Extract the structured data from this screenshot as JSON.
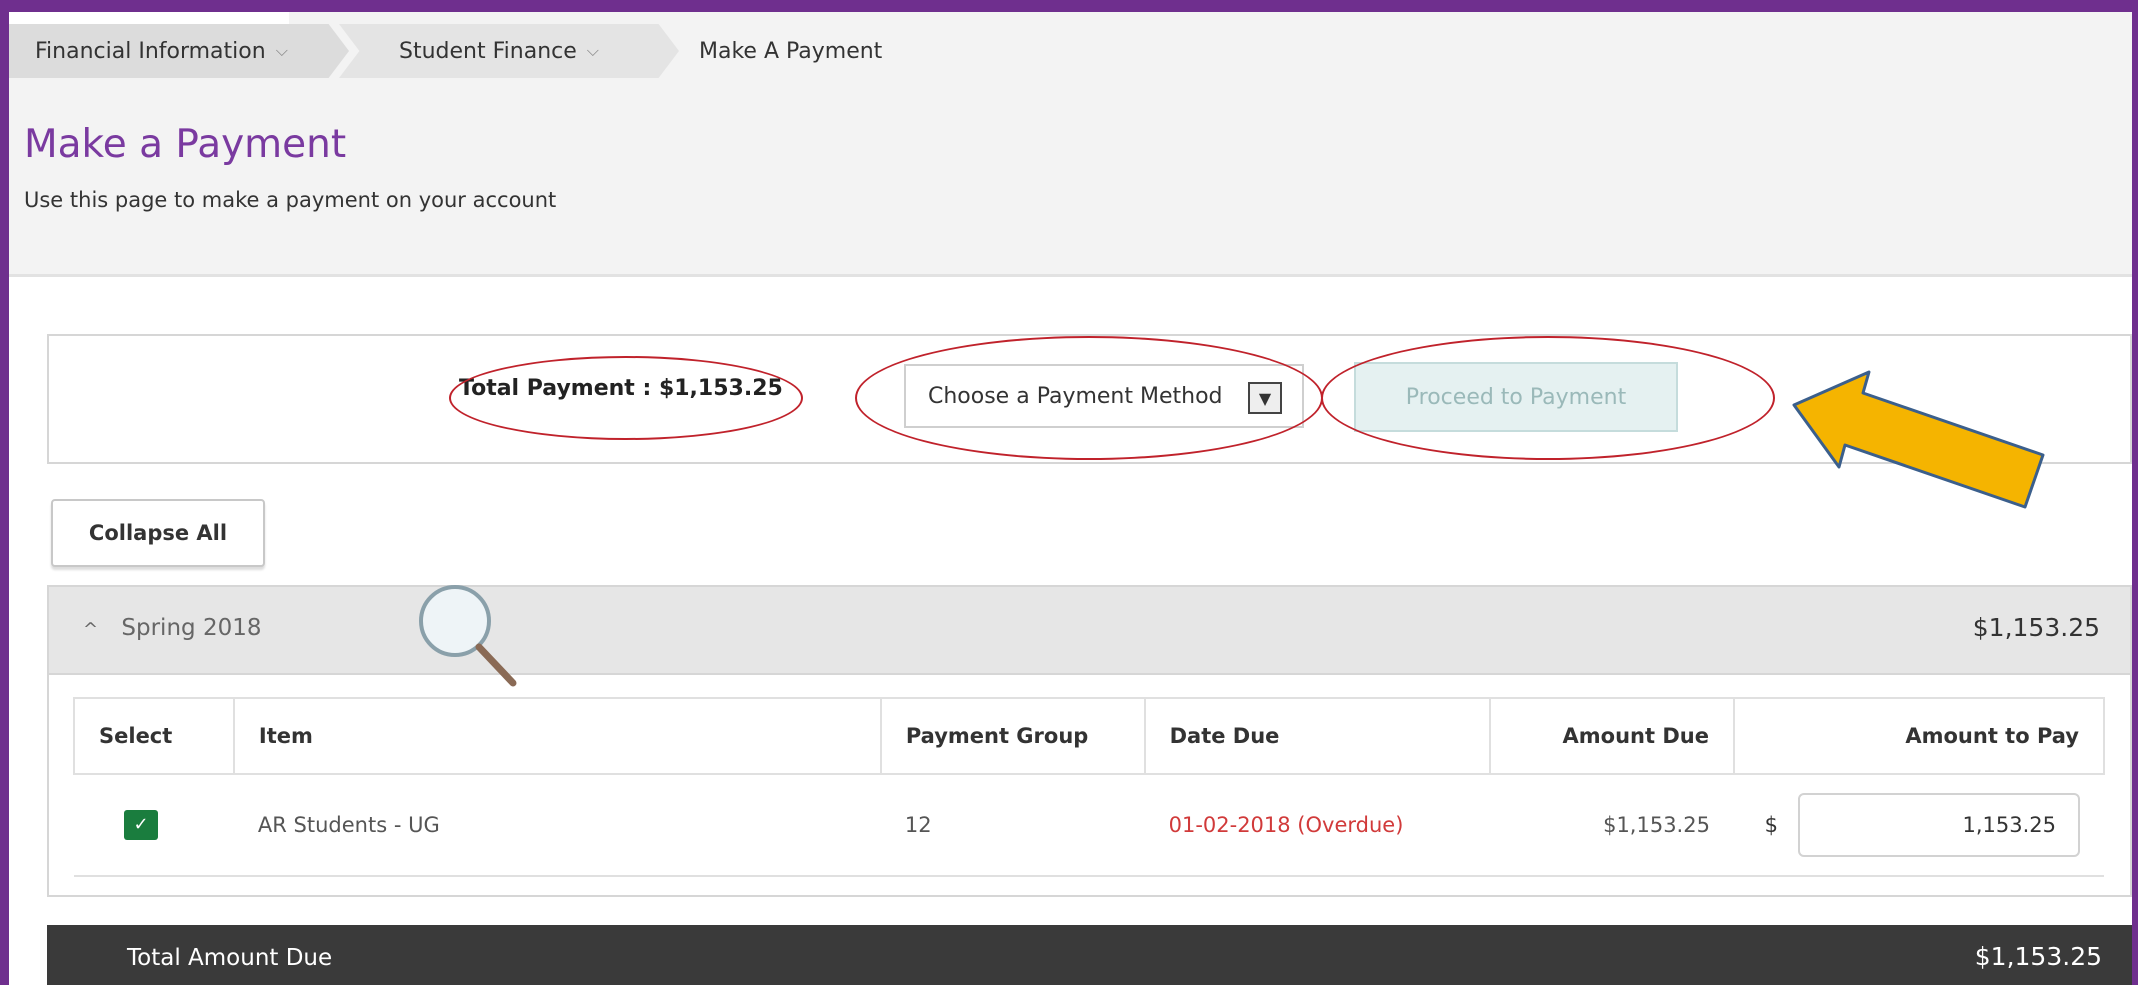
{
  "breadcrumb": {
    "item1": "Financial Information",
    "item2": "Student Finance",
    "item3": "Make A Payment"
  },
  "page": {
    "title": "Make a Payment",
    "subtitle": "Use this page to make a payment on your account"
  },
  "payment_bar": {
    "total_label": "Total Payment : $1,153.25",
    "method_placeholder": "Choose a Payment Method",
    "proceed_label": "Proceed to Payment"
  },
  "collapse_label": "Collapse All",
  "term": {
    "name": "Spring 2018",
    "total": "$1,153.25"
  },
  "table": {
    "headers": {
      "select": "Select",
      "item": "Item",
      "group": "Payment Group",
      "date": "Date Due",
      "amount_due": "Amount Due",
      "amount_pay": "Amount to Pay"
    },
    "rows": [
      {
        "item": "AR Students - UG",
        "group": "12",
        "date_due": "01-02-2018 (Overdue)",
        "amount_due": "$1,153.25",
        "currency": "$",
        "amount_to_pay": "1,153.25"
      }
    ]
  },
  "footer": {
    "label": "Total Amount Due",
    "amount": "$1,153.25"
  },
  "colors": {
    "frame": "#6f2f8e",
    "title": "#7a3aa0",
    "overdue": "#d13a3a",
    "checkbox": "#1a7d3e",
    "annotation_circle": "#c0222b",
    "arrow": "#f5b400"
  },
  "icons": [
    "chevron-down-icon",
    "chevron-up-icon",
    "checkbox-checked-icon",
    "magnifier-icon",
    "arrow-annotation-icon"
  ]
}
